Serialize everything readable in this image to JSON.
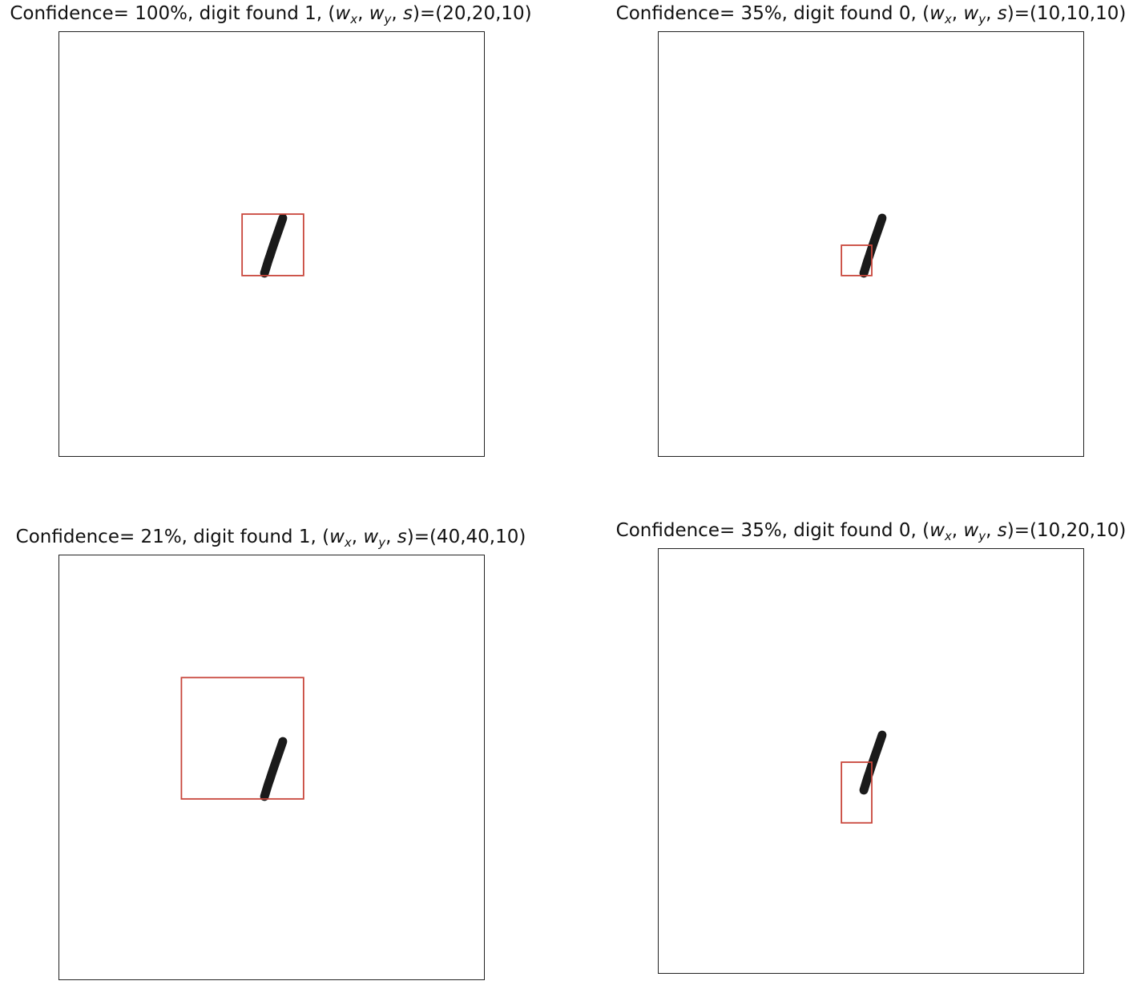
{
  "panels": [
    {
      "confidence_text": "Confidence= 100%, digit found 1, (",
      "wx": "w",
      "wx_sub": "x",
      "wy": "w",
      "wy_sub": "y",
      "s": "s",
      "params_text": ")=(20,20,10)",
      "confidence": 100,
      "digit_found": 1,
      "window": {
        "wx": 20,
        "wy": 20,
        "s": 10
      }
    },
    {
      "confidence_text": "Confidence= 35%, digit found 0, (",
      "wx": "w",
      "wx_sub": "x",
      "wy": "w",
      "wy_sub": "y",
      "s": "s",
      "params_text": ")=(10,10,10)",
      "confidence": 35,
      "digit_found": 0,
      "window": {
        "wx": 10,
        "wy": 10,
        "s": 10
      }
    },
    {
      "confidence_text": "Confidence= 21%, digit found 1, (",
      "wx": "w",
      "wx_sub": "x",
      "wy": "w",
      "wy_sub": "y",
      "s": "s",
      "params_text": ")=(40,40,10)",
      "confidence": 21,
      "digit_found": 1,
      "window": {
        "wx": 40,
        "wy": 40,
        "s": 10
      }
    },
    {
      "confidence_text": "Confidence= 35%, digit found 0, (",
      "wx": "w",
      "wx_sub": "x",
      "wy": "w",
      "wy_sub": "y",
      "s": "s",
      "params_text": ")=(10,20,10)",
      "confidence": 35,
      "digit_found": 0,
      "window": {
        "wx": 10,
        "wy": 20,
        "s": 10
      }
    }
  ],
  "colors": {
    "box": "#c8453a",
    "digit": "#1a1a1a",
    "frame": "#222222"
  },
  "digit_shown": "1"
}
